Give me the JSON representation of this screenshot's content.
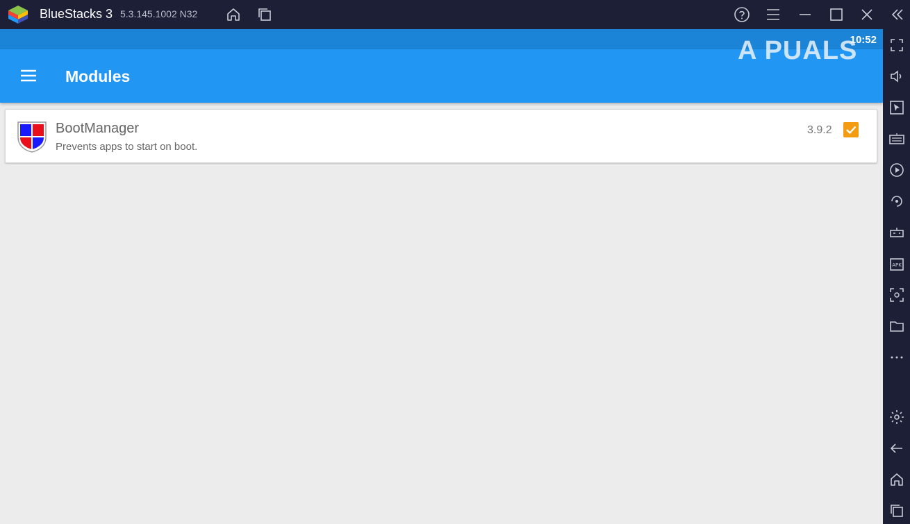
{
  "window": {
    "title": "BlueStacks 3",
    "version": "5.3.145.1002  N32"
  },
  "android": {
    "clock": "10:52",
    "watermark": "A PUALS",
    "appbar": {
      "title": "Modules"
    },
    "modules": [
      {
        "name": "BootManager",
        "description": "Prevents apps to start on boot.",
        "version": "3.9.2",
        "enabled": true
      }
    ]
  },
  "colors": {
    "titlebar": "#1c1f35",
    "statusbar": "#1b84d6",
    "appbar": "#2196f3",
    "checkbox": "#f39c12"
  },
  "icons": {
    "titlebar": [
      "bluestacks-logo",
      "home-icon",
      "multi-instance-icon",
      "help-icon",
      "menu-icon",
      "minimize-icon",
      "maximize-icon",
      "close-icon",
      "collapse-sidebar-icon"
    ],
    "sidebar": [
      "fullscreen-icon",
      "volume-icon",
      "pointer-icon",
      "keyboard-icon",
      "macro-icon",
      "rotate-icon",
      "gamepad-icon",
      "apk-install-icon",
      "screenshot-icon",
      "folder-icon",
      "more-icon",
      "settings-icon",
      "back-icon",
      "home-icon",
      "recents-icon"
    ]
  }
}
